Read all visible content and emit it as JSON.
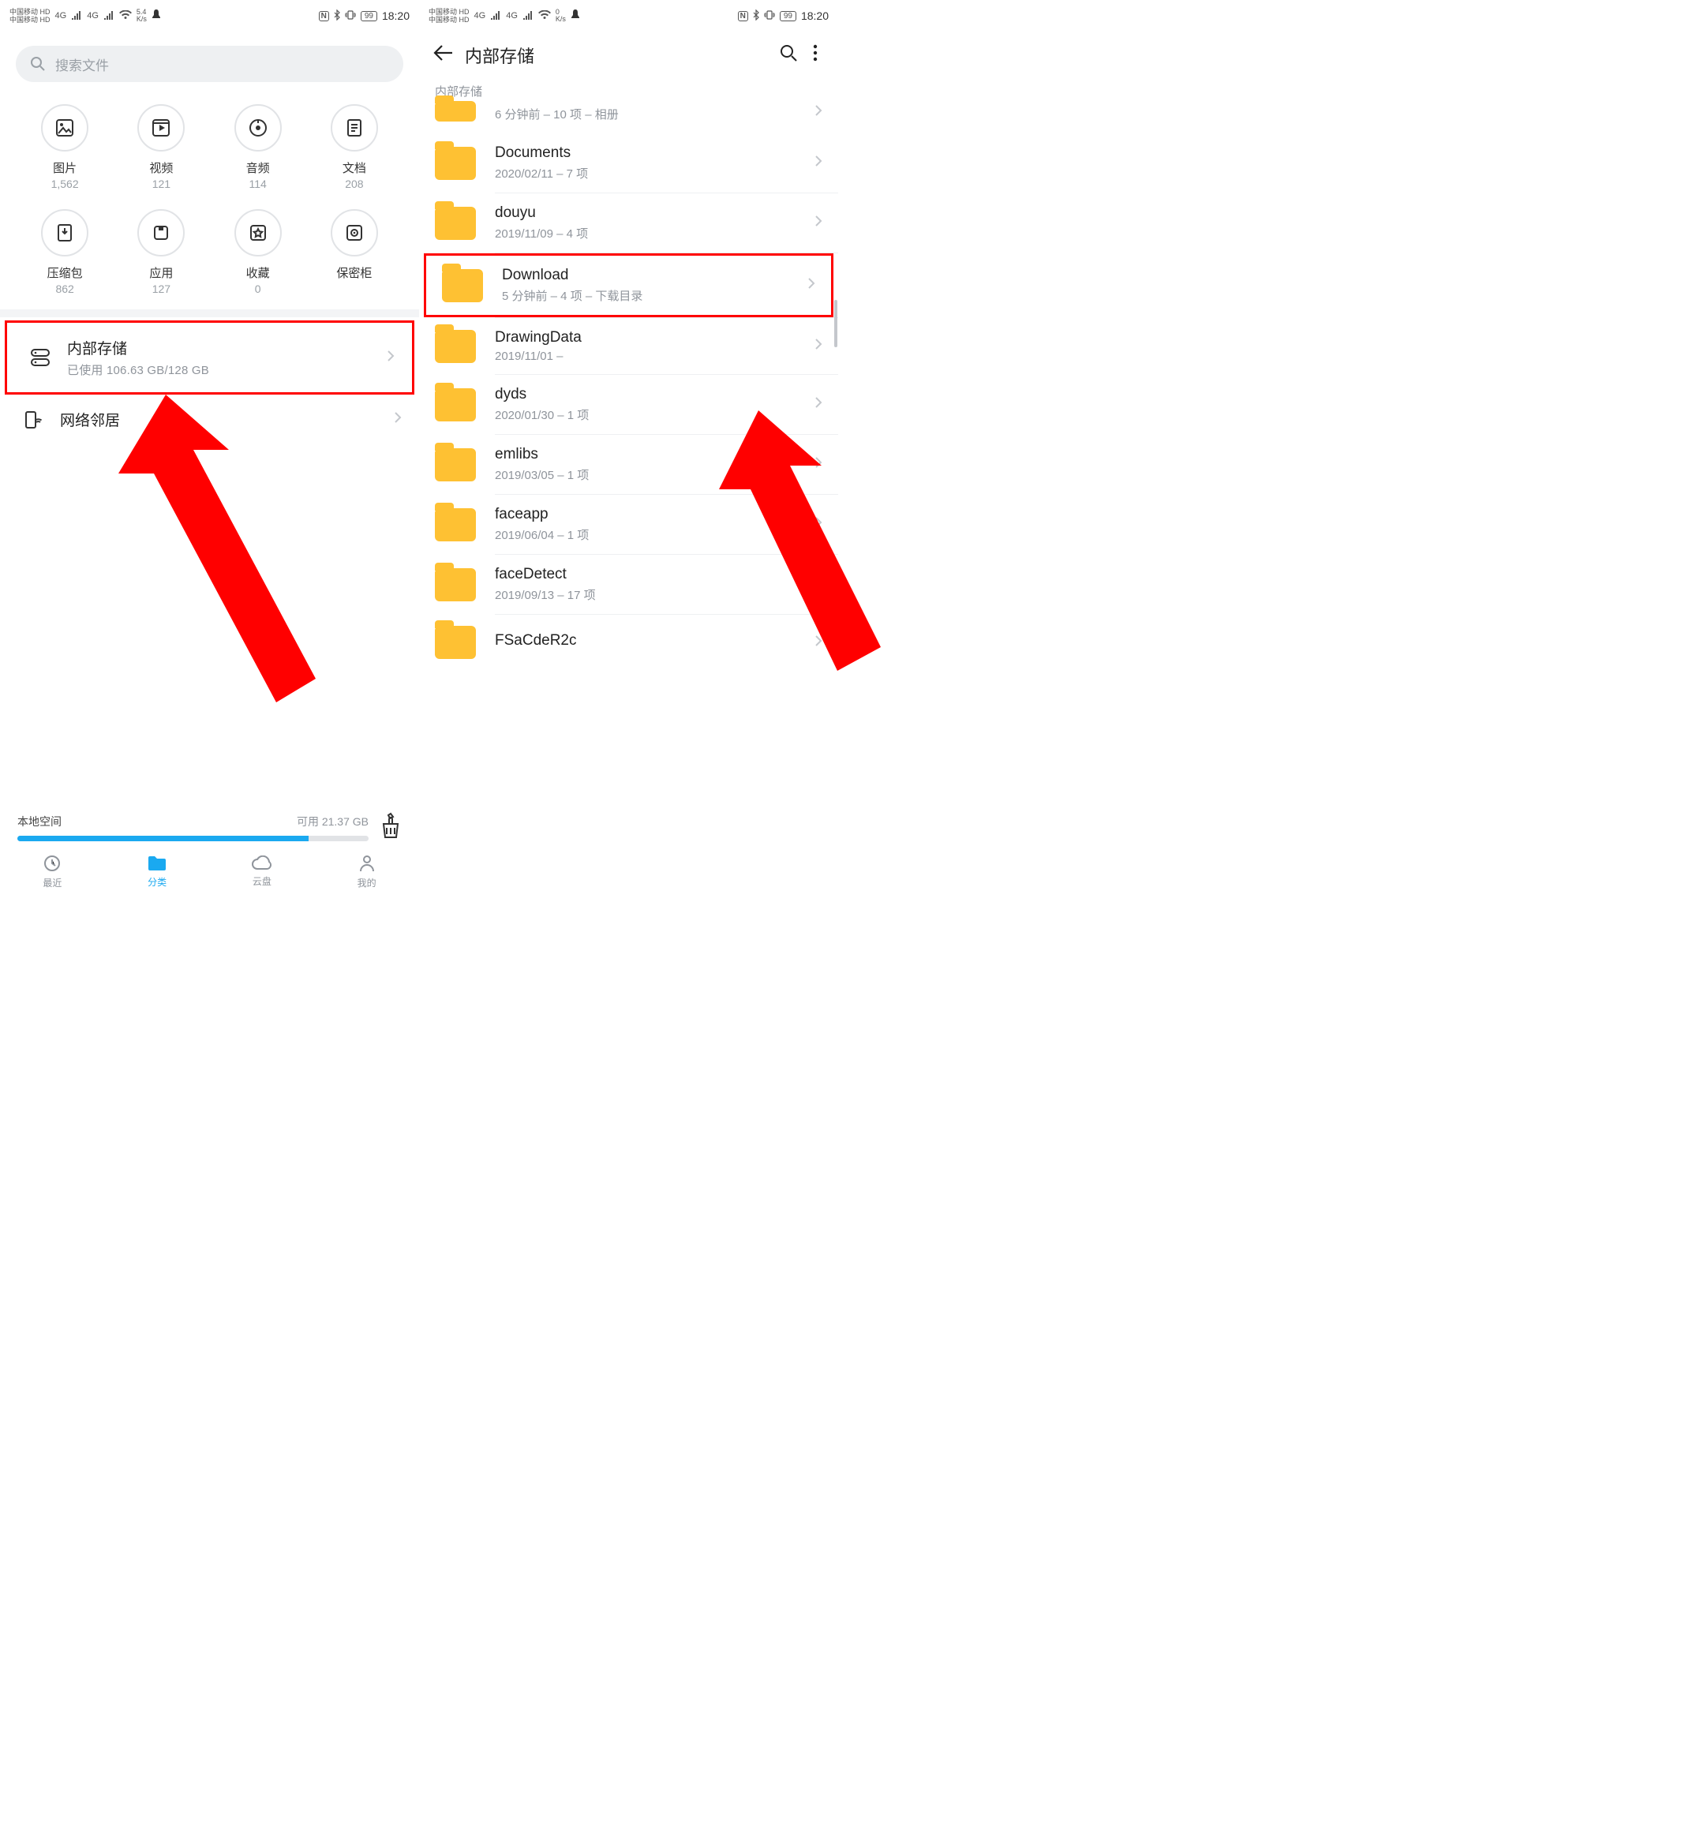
{
  "status": {
    "carrier": "中国移动",
    "hd": "HD",
    "net": "4G",
    "speed_left": "5.4",
    "speed_right": "0",
    "speed_unit": "K/s",
    "battery": "99",
    "time": "18:20"
  },
  "left": {
    "search_placeholder": "搜索文件",
    "categories": [
      {
        "label": "图片",
        "count": "1,562"
      },
      {
        "label": "视频",
        "count": "121"
      },
      {
        "label": "音频",
        "count": "114"
      },
      {
        "label": "文档",
        "count": "208"
      },
      {
        "label": "压缩包",
        "count": "862"
      },
      {
        "label": "应用",
        "count": "127"
      },
      {
        "label": "收藏",
        "count": "0"
      },
      {
        "label": "保密柜",
        "count": ""
      }
    ],
    "internal_title": "内部存储",
    "internal_sub": "已使用 106.63 GB/128 GB",
    "network_title": "网络邻居",
    "local_label": "本地空间",
    "available_label": "可用 21.37 GB",
    "storage_fill_percent": 83,
    "tabs": [
      {
        "label": "最近"
      },
      {
        "label": "分类"
      },
      {
        "label": "云盘"
      },
      {
        "label": "我的"
      }
    ]
  },
  "right": {
    "page_title": "内部存储",
    "breadcrumb": "内部存储",
    "folders": [
      {
        "name": "",
        "meta": "6 分钟前 – 10 项 – 相册"
      },
      {
        "name": "Documents",
        "meta": "2020/02/11 – 7 项"
      },
      {
        "name": "douyu",
        "meta": "2019/11/09 – 4 项"
      },
      {
        "name": "Download",
        "meta": "5 分钟前 – 4 项 – 下载目录"
      },
      {
        "name": "DrawingData",
        "meta": "2019/11/01 –"
      },
      {
        "name": "dyds",
        "meta": "2020/01/30 – 1 项"
      },
      {
        "name": "emlibs",
        "meta": "2019/03/05 – 1 项"
      },
      {
        "name": "faceapp",
        "meta": "2019/06/04 – 1 项"
      },
      {
        "name": "faceDetect",
        "meta": "2019/09/13 – 17 项"
      },
      {
        "name": "FSaCdeR2c",
        "meta": ""
      }
    ],
    "highlight_index": 3
  }
}
